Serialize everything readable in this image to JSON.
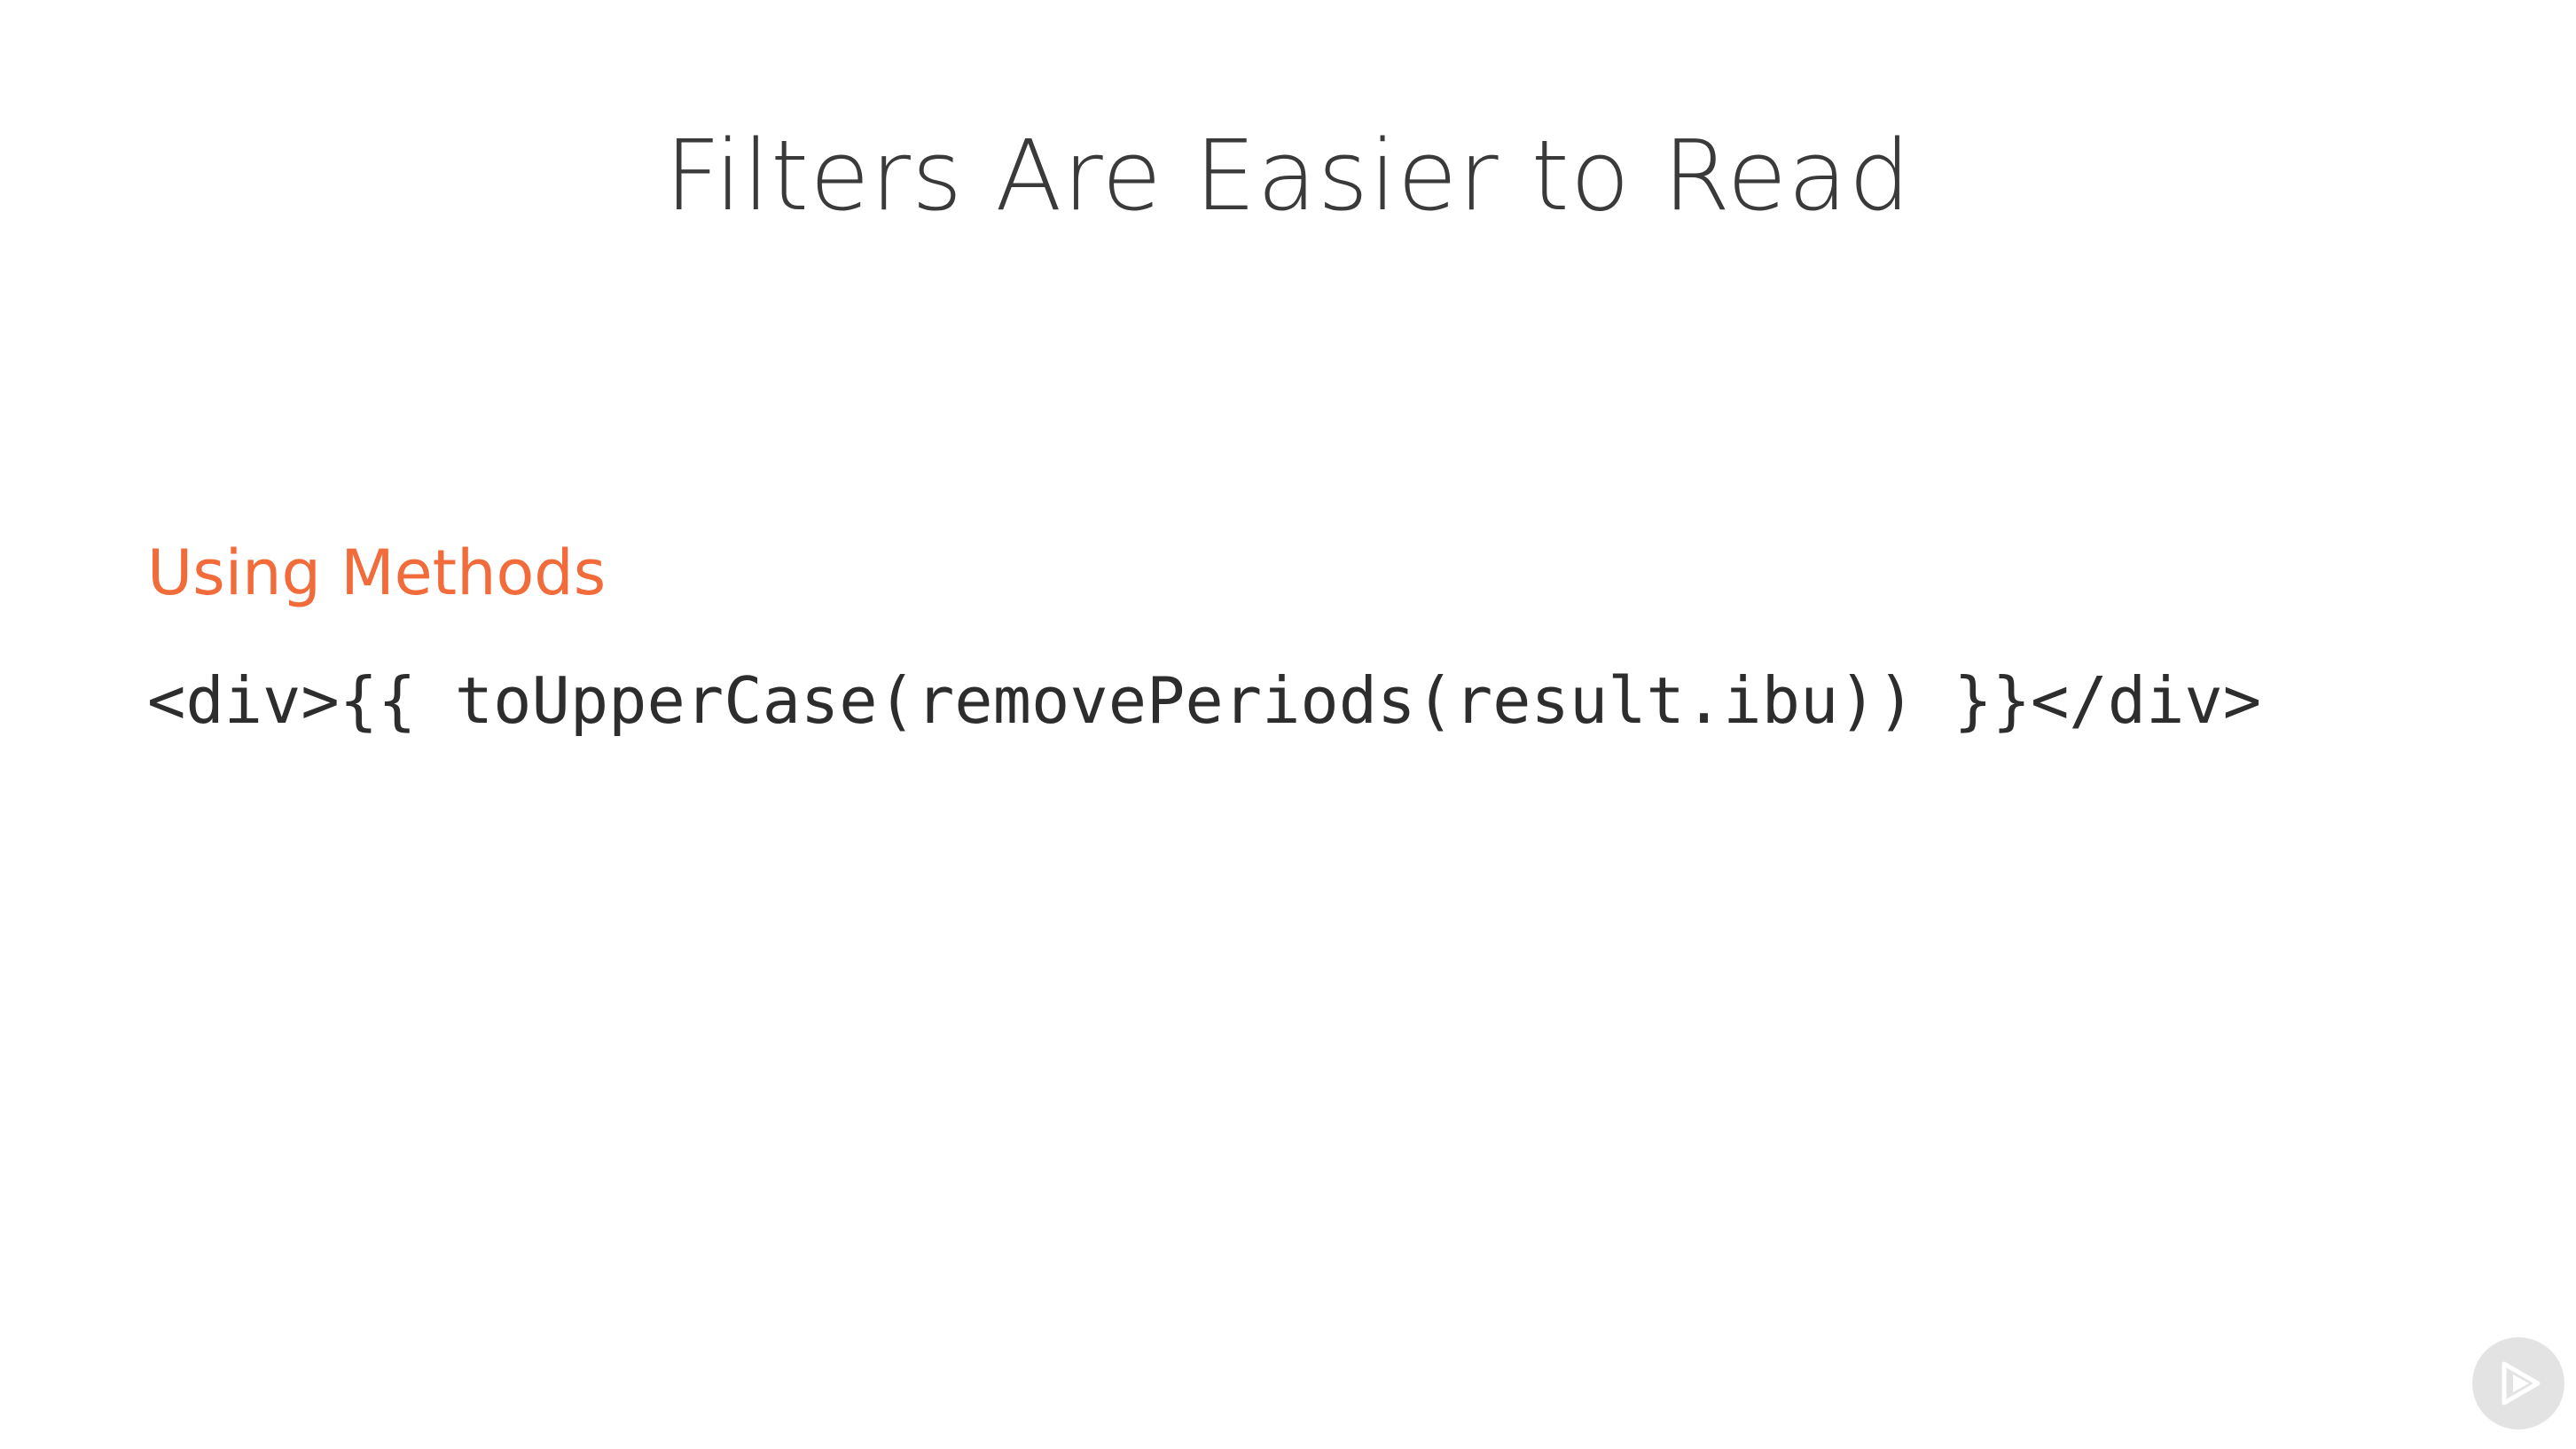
{
  "slide": {
    "title": "Filters Are Easier to Read",
    "section_heading": "Using Methods",
    "code": "<div>{{ toUpperCase(removePeriods(result.ibu)) }}</div>"
  },
  "player": {
    "badge_icon": "play-logo-icon"
  },
  "colors": {
    "heading_accent": "#f26b3a",
    "title_text": "#3a3a3a",
    "code_text": "#2d2d2d",
    "badge_bg": "#e3e3e3"
  }
}
